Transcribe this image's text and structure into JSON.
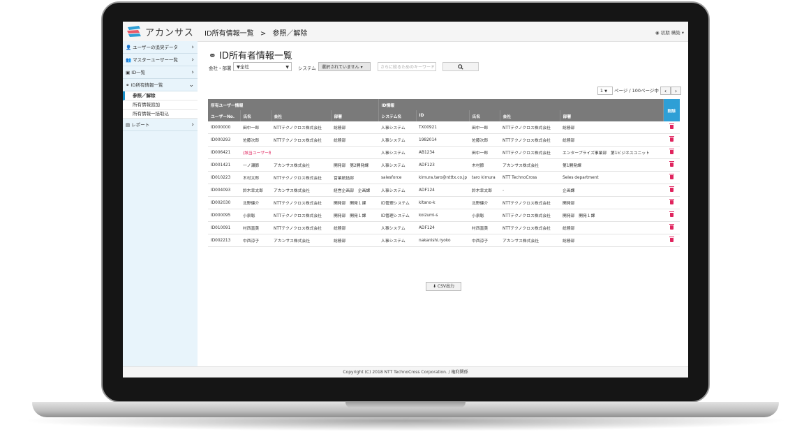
{
  "app": {
    "logo_text": "アカンサス"
  },
  "header": {
    "breadcrumb": [
      "ID所有情報一覧",
      ">",
      "参照／解除"
    ],
    "user": "初期 構築"
  },
  "sidebar": {
    "items": [
      {
        "label": "ユーザーの追突データ"
      },
      {
        "label": "マスターユーザー一覧"
      },
      {
        "label": "ID一覧"
      },
      {
        "label": "ID所有情報一覧"
      }
    ],
    "subitems": [
      {
        "label": "参照／解除"
      },
      {
        "label": "所有情報追加"
      },
      {
        "label": "所有情報一括取込"
      }
    ],
    "report": {
      "label": "レポート"
    }
  },
  "main": {
    "title": "ID所有者情報一覧",
    "filters": {
      "company_label": "会社・部署",
      "company_value": "▼全社",
      "system_label": "システム",
      "system_value": "選択されていません",
      "keyword_placeholder": "さらに絞るためのキーワード"
    },
    "pager": {
      "page": "1",
      "text": "ページ / 100ページ中",
      "prev": "‹",
      "next": "›"
    },
    "table": {
      "group_headers": {
        "owner": "所有ユーザー情報",
        "id": "ID情報",
        "delete": "削除"
      },
      "columns": [
        "ユーザーNo.",
        "氏名",
        "会社",
        "部署",
        "システム名",
        "ID",
        "氏名",
        "会社",
        "部署"
      ],
      "rows": [
        [
          "ID000000",
          "田中一郎",
          "NTTテクノクロス株式会社",
          "総務部",
          "人事システム",
          "TX00921",
          "田中一郎",
          "NTTテクノクロス株式会社",
          "総務部"
        ],
        [
          "ID000293",
          "佐藤次郎",
          "NTTテクノクロス株式会社",
          "総務部",
          "人事システム",
          "1982014",
          "佐藤次郎",
          "NTTテクノクロス株式会社",
          "総務部"
        ],
        [
          "ID006421",
          "(該当ユーザー無し)",
          "",
          "",
          "人事システム",
          "AB1234",
          "田中一郎",
          "NTTテクノクロス株式会社",
          "エンタープライズ事業部　第1ビジネスユニット"
        ],
        [
          "ID001421",
          "一ノ瀬節",
          "アカンサス株式会社",
          "開発部　第2開発課",
          "人事システム",
          "ADF123",
          "木村節",
          "アカンサス株式会社",
          "第1開発課"
        ],
        [
          "ID010223",
          "木村太郎",
          "NTTテクノクロス株式会社",
          "営業統括部",
          "salesforce",
          "kimura.taro@ntttx.co.jp",
          "taro kimura",
          "NTT TechnoCross",
          "Seles department"
        ],
        [
          "ID004093",
          "鈴木幸太郎",
          "アカンサス株式会社",
          "経営企画部　企画課",
          "人事システム",
          "ADF124",
          "鈴木幸太郎",
          "-",
          "企画課"
        ],
        [
          "ID002030",
          "北野健介",
          "NTTテクノクロス株式会社",
          "開発部　開発１課",
          "ID管理システム",
          "kitano-k",
          "北野健介",
          "NTTテクノクロス株式会社",
          "開発部"
        ],
        [
          "ID000095",
          "小泉聡",
          "NTTテクノクロス株式会社",
          "開発部　開発１課",
          "ID管理システム",
          "koizumi-s",
          "小泉聡",
          "NTTテクノクロス株式会社",
          "開発部　開発１課"
        ],
        [
          "ID010091",
          "村西直美",
          "NTTテクノクロス株式会社",
          "総務部",
          "人事システム",
          "ADF124",
          "村西直美",
          "NTTテクノクロス株式会社",
          "総務部"
        ],
        [
          "ID002213",
          "中西涼子",
          "アカンサス株式会社",
          "総務部",
          "人事システム",
          "nakanishi.ryoko",
          "中西涼子",
          "アカンサス株式会社",
          "総務部"
        ]
      ]
    },
    "csv_button": "CSV出力"
  },
  "footer": {
    "copyright": "Copyright (C) 2018 NTT TechnoCross Corporation. / 権利関係"
  },
  "colors": {
    "accent": "#2e9fd6",
    "sidebar_bg": "#e8f4fb",
    "danger": "#e0245e",
    "header_gray": "#7a7a7a"
  }
}
